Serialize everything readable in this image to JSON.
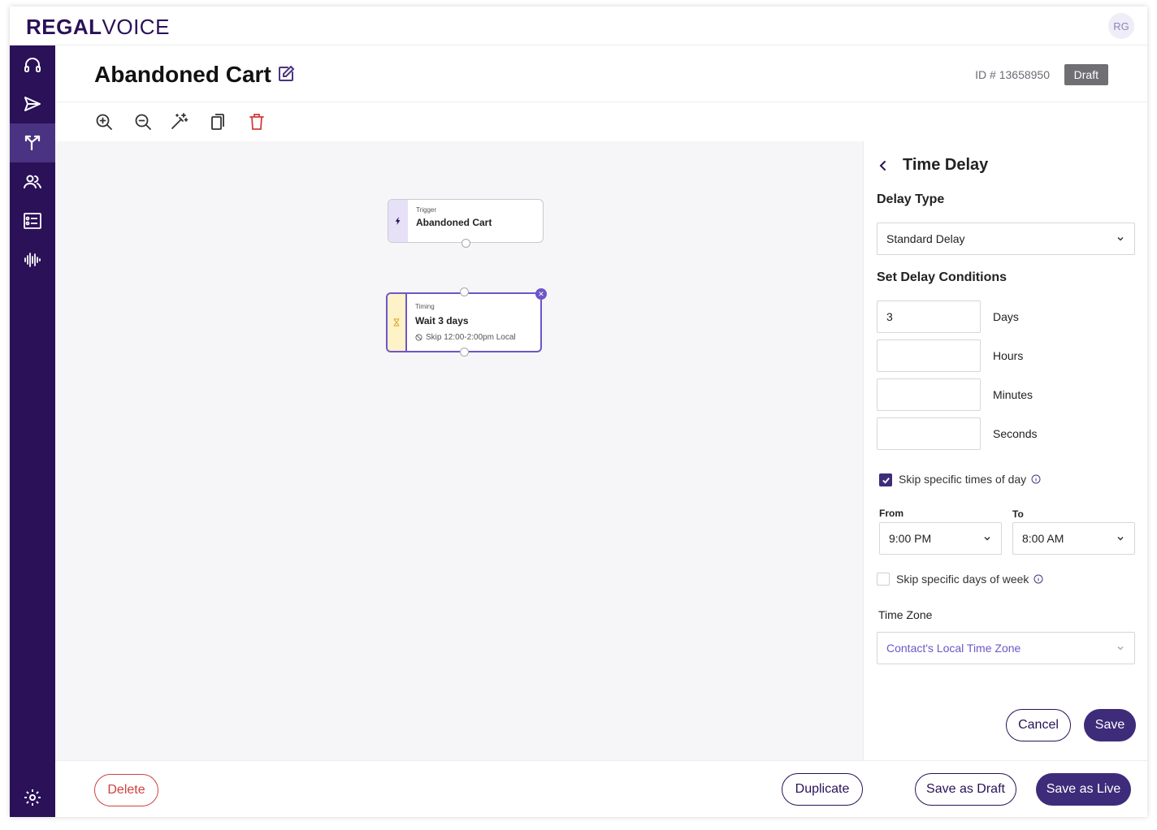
{
  "brand": {
    "logo_bold": "REGAL",
    "logo_light": "VOICE",
    "avatar_initials": "RG",
    "primary_color": "#2a1158",
    "accent_color": "#6d56c7"
  },
  "sidebar": {
    "items": [
      {
        "icon": "headset-icon"
      },
      {
        "icon": "send-icon"
      },
      {
        "icon": "journey-icon",
        "active": true
      },
      {
        "icon": "contacts-icon"
      },
      {
        "icon": "list-icon"
      },
      {
        "icon": "waveform-icon"
      }
    ],
    "settings_icon": "gear-icon"
  },
  "header": {
    "title": "Abandoned Cart",
    "id_text": "ID # 13658950",
    "status_badge": "Draft"
  },
  "toolbar": {
    "tools": [
      "zoom-in-icon",
      "zoom-out-icon",
      "magic-wand-icon",
      "copy-icon",
      "trash-icon"
    ]
  },
  "canvas": {
    "trigger_node": {
      "kind": "Trigger",
      "name": "Abandoned Cart"
    },
    "timing_node": {
      "kind": "Timing",
      "name": "Wait 3 days",
      "sub": "Skip 12:00-2:00pm Local"
    }
  },
  "panel": {
    "title": "Time Delay",
    "delay_type_label": "Delay Type",
    "delay_type_value": "Standard Delay",
    "conditions_label": "Set Delay Conditions",
    "days_value": "3",
    "days_label": "Days",
    "hours_value": "",
    "hours_label": "Hours",
    "minutes_value": "",
    "minutes_label": "Minutes",
    "seconds_value": "",
    "seconds_label": "Seconds",
    "skip_times_label": "Skip specific times of day",
    "skip_times_checked": true,
    "from_label": "From",
    "from_value": "9:00 PM",
    "to_label": "To",
    "to_value": "8:00 AM",
    "skip_days_label": "Skip specific days of week",
    "skip_days_checked": false,
    "timezone_label": "Time Zone",
    "timezone_value": "Contact's Local Time Zone",
    "cancel_label": "Cancel",
    "save_label": "Save"
  },
  "footer": {
    "delete_label": "Delete",
    "duplicate_label": "Duplicate",
    "save_draft_label": "Save as Draft",
    "save_live_label": "Save as Live"
  }
}
